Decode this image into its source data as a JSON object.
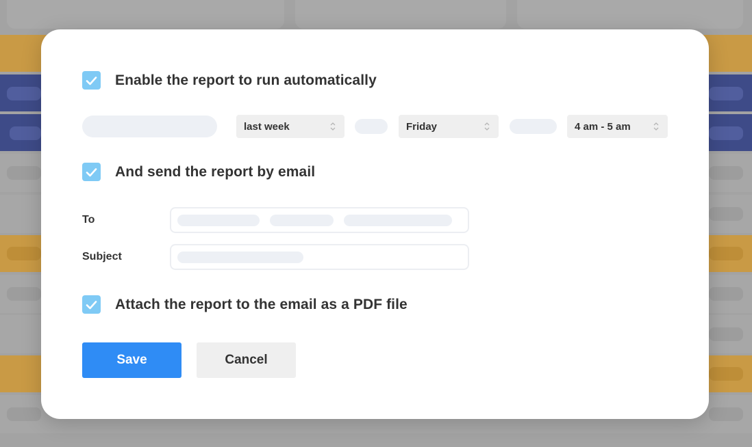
{
  "schedule": {
    "enable_label": "Enable the report to run automatically",
    "enable_checked": true,
    "period_select": "last week",
    "day_select": "Friday",
    "time_select": "4 am - 5 am"
  },
  "email": {
    "send_label": "And send the report by email",
    "send_checked": true,
    "to_label": "To",
    "subject_label": "Subject"
  },
  "attach": {
    "label": "Attach the report to the email as a PDF file",
    "checked": true
  },
  "buttons": {
    "save": "Save",
    "cancel": "Cancel"
  },
  "colors": {
    "checkbox": "#7fcaf5",
    "primary": "#2f8cf5",
    "background_orange": "#d09a40",
    "background_navy": "#3b4a8a"
  }
}
